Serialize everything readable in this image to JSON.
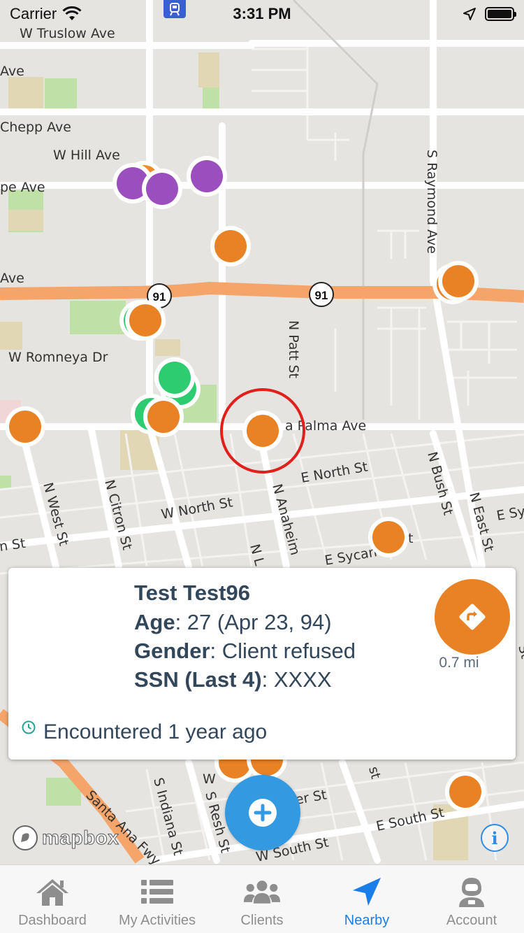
{
  "status_bar": {
    "carrier": "Carrier",
    "time": "3:31 PM"
  },
  "map": {
    "street_labels": [
      "W Truslow Ave",
      "Ave",
      "Chepp Ave",
      "W Hill Ave",
      "pe Ave",
      "Ave",
      "W Romneya Dr",
      "a Palma Ave",
      "N Patt St",
      "S Raymond Ave",
      "E North St",
      "W North St",
      "N West St",
      "N Citron St",
      "N Anaheim",
      "N Bush St",
      "N East St",
      "E Sy",
      "n St",
      "E Sycan",
      "t",
      "N L",
      "W",
      "er St",
      "E South St",
      "W South St",
      "S Indiana St",
      "S Resh St",
      "Santa Ana Fwy",
      "st",
      "St"
    ],
    "highway_shield": "91",
    "marker_colors": {
      "orange": "#e98224",
      "purple": "#9b4fbe",
      "green": "#2ecc71",
      "selection_ring": "#e0201a"
    }
  },
  "client_card": {
    "name": "Test Test96",
    "age_label": "Age",
    "age_value": ": 27 (Apr 23, 94)",
    "gender_label": "Gender",
    "gender_value": ": Client refused",
    "ssn_label": "SSN (Last 4)",
    "ssn_value": ": XXXX",
    "distance": "0.7 mi",
    "encountered": "Encountered 1 year ago",
    "directions_icon": "directions-icon",
    "clock_icon": "clock-icon"
  },
  "map_controls": {
    "mapbox_logo": "mapbox",
    "info_icon": "i"
  },
  "tabs": [
    {
      "label": "Dashboard",
      "icon": "home-icon"
    },
    {
      "label": "My Activities",
      "icon": "list-icon"
    },
    {
      "label": "Clients",
      "icon": "users-icon"
    },
    {
      "label": "Nearby",
      "icon": "navigation-arrow-icon"
    },
    {
      "label": "Account",
      "icon": "astronaut-icon"
    }
  ],
  "active_tab": "Nearby",
  "colors": {
    "accent_blue": "#1a7ee8",
    "fab_blue": "#3399e0",
    "text_dark": "#33475b"
  }
}
